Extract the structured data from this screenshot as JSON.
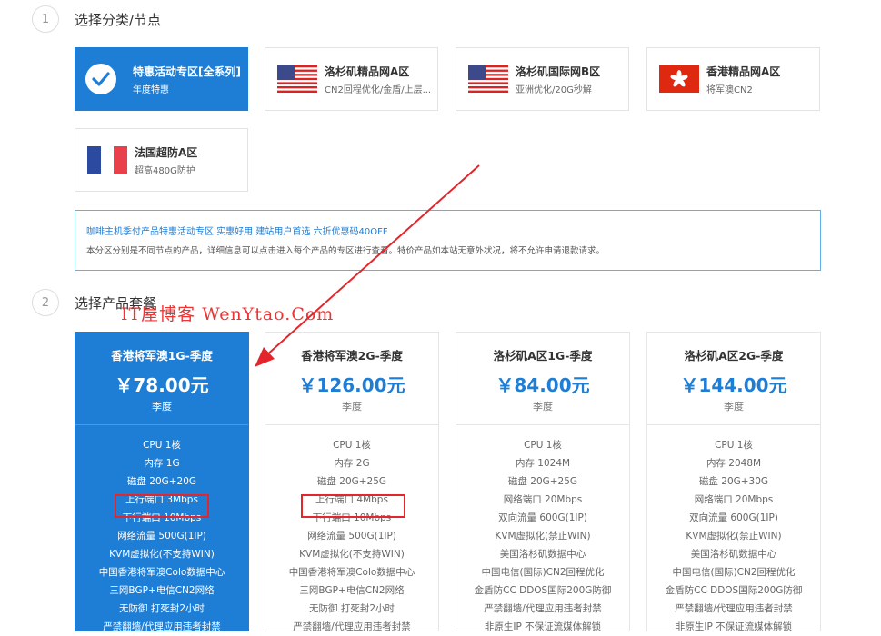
{
  "steps": {
    "step1_number": "1",
    "step1_title": "选择分类/节点",
    "step2_number": "2",
    "step2_title": "选择产品套餐"
  },
  "categories": [
    {
      "name": "特惠活动专区[全系列]",
      "desc": "年度特惠",
      "icon": "check-icon",
      "active": true
    },
    {
      "name": "洛杉矶精品网A区",
      "desc": "CN2回程优化/金盾/上层...",
      "icon": "us-flag-icon"
    },
    {
      "name": "洛杉矶国际网B区",
      "desc": "亚洲优化/20G秒解",
      "icon": "us-flag-icon"
    },
    {
      "name": "香港精品网A区",
      "desc": "将军澳CN2",
      "icon": "hk-flag-icon"
    },
    {
      "name": "法国超防A区",
      "desc": "超高480G防护",
      "icon": "fr-flag-icon"
    }
  ],
  "notice": {
    "line1": "咖啡主机季付产品特惠活动专区 实惠好用 建站用户首选 六折优惠码40OFF",
    "line2": "本分区分别是不同节点的产品，详细信息可以点击进入每个产品的专区进行查看。特价产品如本站无意外状况，将不允许申请退款请求。"
  },
  "watermark": "IT屋博客 WenYtao.Com",
  "plans": [
    {
      "name": "香港将军澳1G-季度",
      "price": "￥78.00元",
      "period": "季度",
      "features": [
        "CPU 1核",
        "内存 1G",
        "磁盘 20G+20G",
        "上行端口 3Mbps",
        "下行端口 10Mbps",
        "网络流量 500G(1IP)",
        "KVM虚拟化(不支持WIN)",
        "中国香港将军澳Colo数据中心",
        "三网BGP+电信CN2网络",
        "无防御 打死封2小时",
        "严禁翻墙/代理应用违者封禁"
      ]
    },
    {
      "name": "香港将军澳2G-季度",
      "price": "￥126.00元",
      "period": "季度",
      "features": [
        "CPU 1核",
        "内存 2G",
        "磁盘 20G+25G",
        "上行端口 4Mbps",
        "下行端口 10Mbps",
        "网络流量 500G(1IP)",
        "KVM虚拟化(不支持WIN)",
        "中国香港将军澳Colo数据中心",
        "三网BGP+电信CN2网络",
        "无防御 打死封2小时",
        "严禁翻墙/代理应用违者封禁"
      ]
    },
    {
      "name": "洛杉矶A区1G-季度",
      "price": "￥84.00元",
      "period": "季度",
      "features": [
        "CPU 1核",
        "内存 1024M",
        "磁盘 20G+25G",
        "网络端口 20Mbps",
        "双向流量 600G(1IP)",
        "KVM虚拟化(禁止WIN)",
        "美国洛杉矶数据中心",
        "中国电信(国际)CN2回程优化",
        "金盾防CC DDOS国际200G防御",
        "严禁翻墙/代理应用违者封禁",
        "非原生IP 不保证流媒体解锁"
      ]
    },
    {
      "name": "洛杉矶A区2G-季度",
      "price": "￥144.00元",
      "period": "季度",
      "features": [
        "CPU 1核",
        "内存 2048M",
        "磁盘 20G+30G",
        "网络端口 20Mbps",
        "双向流量 600G(1IP)",
        "KVM虚拟化(禁止WIN)",
        "美国洛杉矶数据中心",
        "中国电信(国际)CN2回程优化",
        "金盾防CC DDOS国际200G防御",
        "严禁翻墙/代理应用违者封禁",
        "非原生IP 不保证流媒体解锁"
      ]
    }
  ],
  "colors": {
    "accent": "#1e7ed6",
    "highlight": "#e3262b"
  }
}
